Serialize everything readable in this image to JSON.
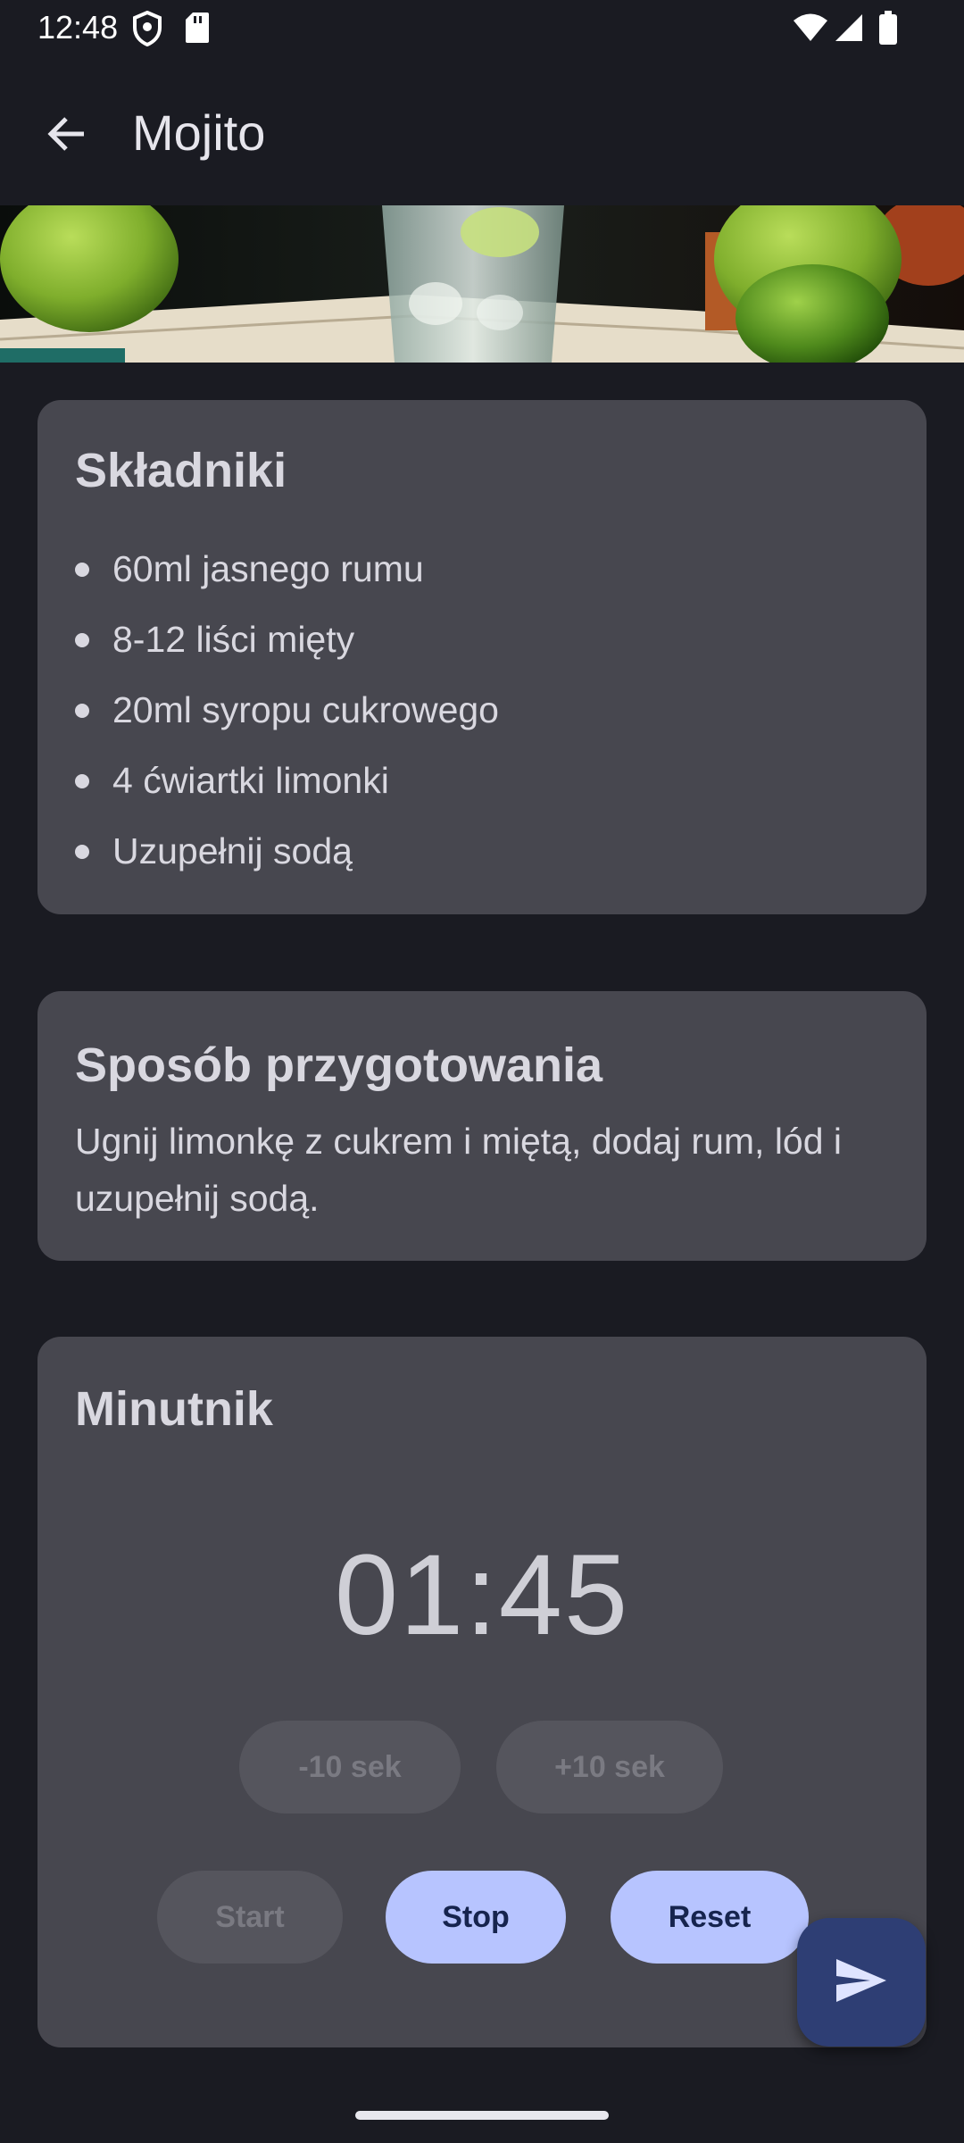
{
  "status_bar": {
    "time": "12:48",
    "icons": [
      "shield-icon",
      "sd-card-icon",
      "wifi-icon",
      "signal-icon",
      "battery-icon"
    ]
  },
  "app_bar": {
    "back_icon": "arrow-back-icon",
    "title": "Mojito"
  },
  "hero": {
    "image": "mojito-photo"
  },
  "ingredients": {
    "title": "Składniki",
    "items": [
      "60ml jasnego rumu",
      "8-12 liści mięty",
      "20ml syropu cukrowego",
      "4 ćwiartki limonki",
      "Uzupełnij sodą"
    ]
  },
  "method": {
    "title": "Sposób przygotowania",
    "text": "Ugnij limonkę z cukrem i miętą, dodaj rum, lód i uzupełnij sodą."
  },
  "timer": {
    "title": "Minutnik",
    "display": "01:45",
    "minus_label": "-10 sek",
    "plus_label": "+10 sek",
    "start_label": "Start",
    "stop_label": "Stop",
    "reset_label": "Reset"
  },
  "fab": {
    "icon": "send-icon"
  },
  "colors": {
    "background": "#1a1b22",
    "card": "#47474f",
    "accent_button": "#b7c4ff",
    "fab": "#2e3e74"
  }
}
